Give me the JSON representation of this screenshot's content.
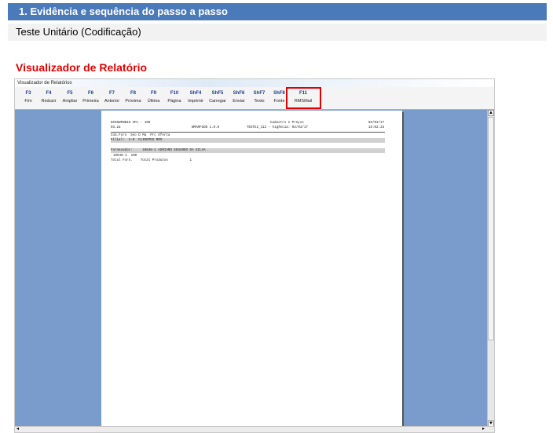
{
  "doc": {
    "section_title": "1.   Evidência e sequência do passo a passo",
    "subtitle": "Teste Unitário (Codificação)",
    "report_heading": "Visualizador de Relatório"
  },
  "window": {
    "title": "Visualizador de Relatórios",
    "toolbar": [
      {
        "key": "F3",
        "label": "Fim"
      },
      {
        "key": "F4",
        "label": "Reduzir"
      },
      {
        "key": "F5",
        "label": "Ampliar"
      },
      {
        "key": "F6",
        "label": "Primeira"
      },
      {
        "key": "F7",
        "label": "Anterior"
      },
      {
        "key": "F8",
        "label": "Próxima"
      },
      {
        "key": "F9",
        "label": "Última"
      },
      {
        "key": "F10",
        "label": "Página"
      },
      {
        "key": "ShF4",
        "label": "Imprimir"
      },
      {
        "key": "ShF5",
        "label": "Carregar"
      },
      {
        "key": "ShF6",
        "label": "Enviar"
      },
      {
        "key": "ShF7",
        "label": "Texto"
      },
      {
        "key": "ShF8",
        "label": "Fonte"
      },
      {
        "key": "F11",
        "label": "RMSMail"
      }
    ]
  },
  "report": {
    "header_left1": "DXXDWPWN48 XPL - 100",
    "header_left2": "03.2a",
    "header_mid1": "WMARFGDD 1.0.0",
    "header_center1": "Cadastro e Preços",
    "header_center2": "TESTE2_112 - Vigência: 03/03/17",
    "header_right1": "03/03/17",
    "header_right2": "15:02:23",
    "columns": "Cód.Forn  Seo D Ma  Prc Oferta",
    "filial": "Filial:  1-9  CLIENTES RMS",
    "fornecedor": "Fornecedor:     10648-1 ADRIANO EDUARDO DA SILVA",
    "row1": "10648-1  100",
    "totals": "Total Forn.    Total Produtos           1"
  },
  "icons": {
    "scroll_up": "▲",
    "scroll_down": "▼",
    "scroll_left": "◂",
    "scroll_right": "▸"
  }
}
